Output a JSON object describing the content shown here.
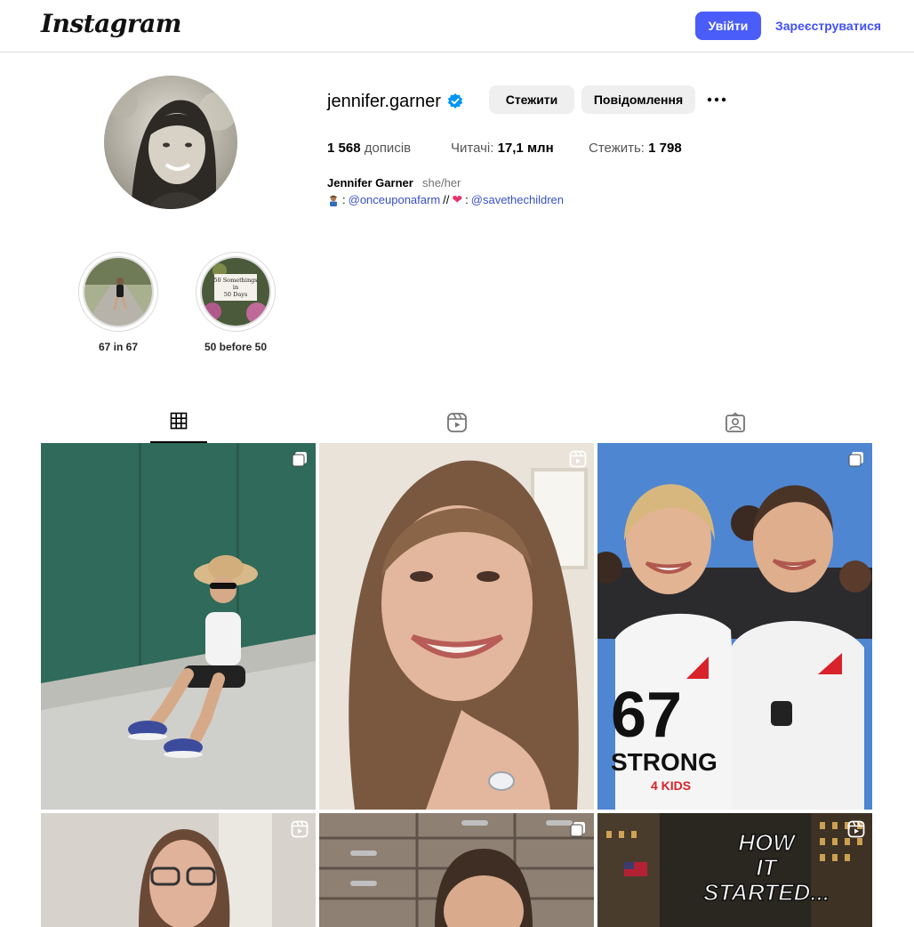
{
  "topbar": {
    "logo": "Instagram",
    "login_label": "Увійти",
    "signup_label": "Зареєструватися",
    "accent_color": "#4a5df9"
  },
  "profile": {
    "username": "jennifer.garner",
    "verified": true,
    "follow_label": "Стежити",
    "message_label": "Повідомлення",
    "stats": {
      "posts_value": "1 568",
      "posts_label": "дописів",
      "followers_label": "Читачі:",
      "followers_value": "17,1 млн",
      "following_label": "Стежить:",
      "following_value": "1 798"
    },
    "full_name": "Jennifer Garner",
    "pronouns": "she/her",
    "bio": {
      "sep1": ":",
      "link1": "@onceuponafarm",
      "divider": "//",
      "sep2": ":",
      "link2": "@savethechildren"
    }
  },
  "highlights": [
    {
      "label": "67 in 67"
    },
    {
      "label": "50 before 50",
      "cover_text": [
        "50 Somethings",
        "in",
        "50 Days"
      ]
    }
  ],
  "tabs": [
    {
      "name": "posts",
      "icon": "grid-icon",
      "active": true
    },
    {
      "name": "reels",
      "icon": "reels-icon",
      "active": false
    },
    {
      "name": "tagged",
      "icon": "tagged-icon",
      "active": false
    }
  ],
  "posts": [
    {
      "badge": "carousel-icon",
      "overlay_text": ""
    },
    {
      "badge": "reel-icon",
      "overlay_text": ""
    },
    {
      "badge": "carousel-icon",
      "overlay_text": "",
      "shirt_text": [
        "67",
        "STRONG",
        "4 KIDS"
      ]
    },
    {
      "badge": "reel-icon",
      "overlay_text": ""
    },
    {
      "badge": "carousel-icon",
      "overlay_text": ""
    },
    {
      "badge": "reel-icon",
      "overlay_lines": [
        "HOW",
        "IT",
        "STARTED..."
      ]
    }
  ]
}
